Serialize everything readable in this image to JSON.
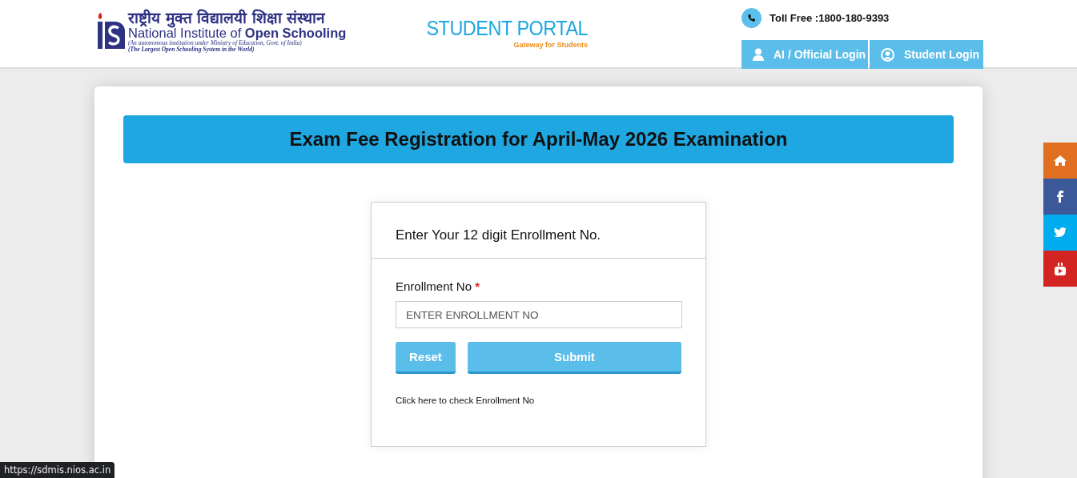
{
  "header": {
    "logo": {
      "hindi_name": "राष्ट्रीय मुक्त विद्यालयी शिक्षा संस्थान",
      "english_name_prefix": "National Institute of ",
      "english_name_bold": "Open Schooling",
      "tagline_1": "(An autonomous institution under Ministry of Education, Govt. of India)",
      "tagline_2": "(The Largest Open Schooling System in the World)"
    },
    "portal": {
      "title": "STUDENT PORTAL",
      "subtitle": "Gateway for Students"
    },
    "toll_free": "Toll Free :1800-180-9393",
    "login_buttons": [
      {
        "label": "AI / Official Login",
        "kind": "person"
      },
      {
        "label": "Student Login",
        "kind": "account"
      }
    ]
  },
  "banner": {
    "title": "Exam Fee Registration for April-May 2026 Examination"
  },
  "form": {
    "heading": "Enter Your 12 digit Enrollment No.",
    "field_label": "Enrollment No",
    "required_mark": "*",
    "placeholder": "ENTER ENROLLMENT NO",
    "buttons": [
      {
        "label": "Reset",
        "kind": "reset"
      },
      {
        "label": "Submit",
        "kind": "submit"
      }
    ],
    "link": "Click here to check Enrollment No"
  },
  "social_bar": [
    {
      "kind": "home",
      "color": "#e07020"
    },
    {
      "kind": "facebook",
      "color": "#3b5998"
    },
    {
      "kind": "twitter",
      "color": "#00aced"
    },
    {
      "kind": "youtube",
      "color": "#d42421"
    }
  ],
  "status_url": "https://sdmis.nios.ac.in"
}
